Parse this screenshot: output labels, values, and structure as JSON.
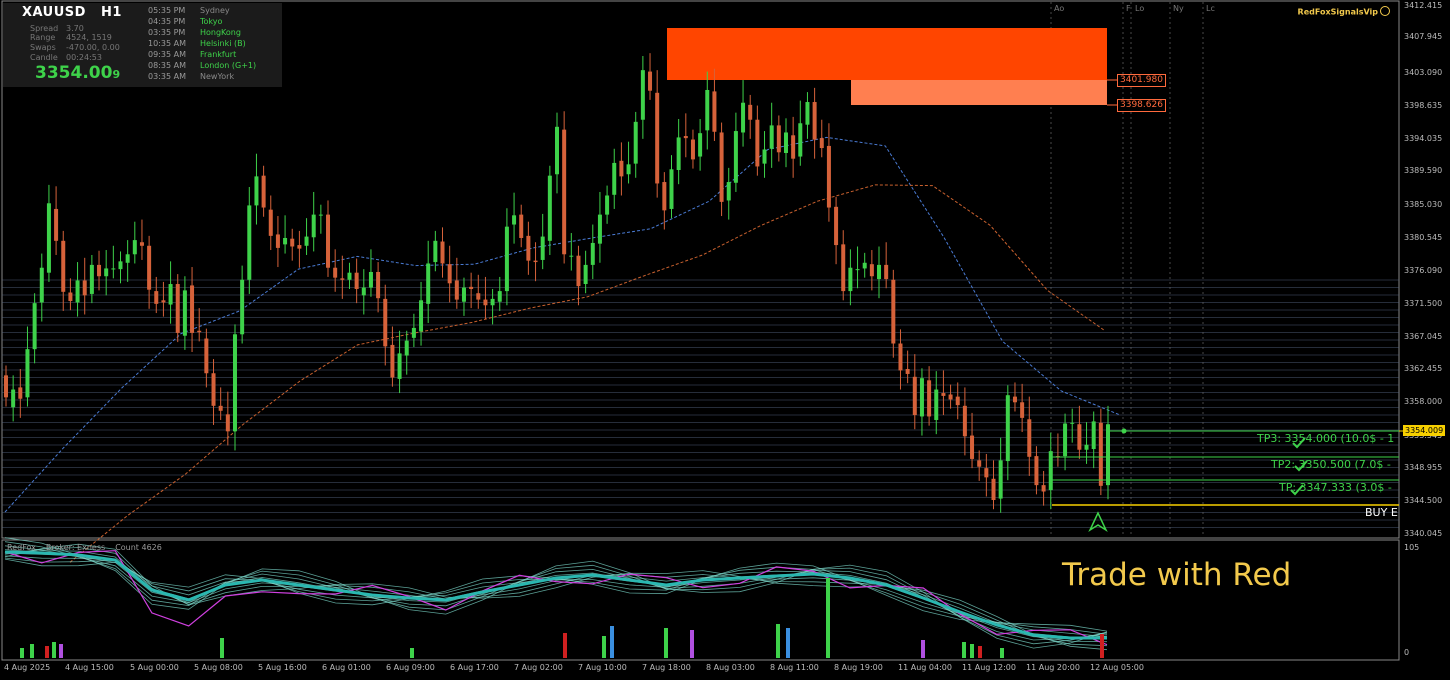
{
  "symbol": {
    "name": "XAUUSD",
    "timeframe": "H1"
  },
  "info": [
    {
      "label": "Spread",
      "value": "3.70"
    },
    {
      "label": "Range",
      "value": "4524, 1519"
    },
    {
      "label": "Swaps",
      "value": "-470.00, 0.00"
    },
    {
      "label": "Candle",
      "value": "00:24:53"
    }
  ],
  "bid": {
    "main": "3354.00",
    "last_digit": "9"
  },
  "sessions": [
    {
      "time": "05:35 PM",
      "city": "Sydney",
      "color": "#8a8a8a"
    },
    {
      "time": "04:35 PM",
      "city": "Tokyo",
      "color": "#3ed24a"
    },
    {
      "time": "03:35 PM",
      "city": "HongKong",
      "color": "#3ed24a"
    },
    {
      "time": "10:35 AM",
      "city": "Helsinki  (B)",
      "color": "#3ed24a"
    },
    {
      "time": "09:35 AM",
      "city": "Frankfurt",
      "color": "#3ed24a"
    },
    {
      "time": "08:35 AM",
      "city": "London  (G+1)",
      "color": "#3ed24a"
    },
    {
      "time": "03:35 AM",
      "city": "NewYork",
      "color": "#8a8a8a"
    }
  ],
  "brand": "RedFoxSignalsVip",
  "separators": [
    "Ao",
    "F",
    "Lo",
    "Ny",
    "Lc"
  ],
  "price_axis": [
    "3412.415",
    "3407.945",
    "3403.090",
    "3398.635",
    "3394.035",
    "3389.590",
    "3385.030",
    "3380.545",
    "3376.090",
    "3371.500",
    "3367.045",
    "3362.455",
    "3358.000",
    "3353.545",
    "3348.955",
    "3344.500",
    "3340.045"
  ],
  "current_price": "3354.009",
  "zones": [
    {
      "price": "3401.980",
      "color": "#ff4500"
    },
    {
      "price": "3398.626",
      "color": "#ff7f50"
    }
  ],
  "targets": [
    {
      "text": "TP3: 3354.000 (10.0$ - 1"
    },
    {
      "text": "TP2: 3350.500 (7.0$ -"
    },
    {
      "text": "TP: 3347.333 (3.0$ -"
    }
  ],
  "entry": {
    "text": "BUY E"
  },
  "indicator": {
    "name": "RedFox",
    "broker": "Broker: Exness",
    "count": "Count  4626",
    "scale_top": "105",
    "scale_bottom": "0"
  },
  "slogan": "Trade with Red",
  "time_axis": [
    "4 Aug 2025",
    "4 Aug 15:00",
    "5 Aug 00:00",
    "5 Aug 08:00",
    "5 Aug 16:00",
    "6 Aug 01:00",
    "6 Aug 09:00",
    "6 Aug 17:00",
    "7 Aug 02:00",
    "7 Aug 10:00",
    "7 Aug 18:00",
    "8 Aug 03:00",
    "8 Aug 11:00",
    "8 Aug 19:00",
    "11 Aug 04:00",
    "11 Aug 12:00",
    "11 Aug 20:00",
    "12 Aug 05:00"
  ],
  "colors": {
    "bull": "#3ed24a",
    "bear": "#d6623a",
    "background": "#000000",
    "grid": "#5a6a8a",
    "ma_fast": "#4a7bd4",
    "ma_slow": "#c8602e"
  },
  "chart_data": {
    "type": "candlestick",
    "ylim": [
      3338.5,
      3413.2
    ],
    "candles": [
      [
        3360.9,
        3357.8
      ],
      [
        3356.4,
        3358.9
      ],
      [
        3359.2,
        3357.6
      ],
      [
        3357.8,
        3364.6
      ],
      [
        3364.6,
        3371.1
      ],
      [
        3371.2,
        3376.1
      ],
      [
        3375.4,
        3385.2
      ],
      [
        3384.4,
        3379.9
      ],
      [
        3379.9,
        3372.7
      ],
      [
        3372.6,
        3371.4
      ],
      [
        3371.2,
        3374.3
      ],
      [
        3374.3,
        3372.2
      ],
      [
        3372.4,
        3376.5
      ],
      [
        3376.5,
        3374.9
      ],
      [
        3374.9,
        3376.0
      ],
      [
        3375.9,
        3376.0
      ],
      [
        3375.9,
        3377.0
      ],
      [
        3376.8,
        3378.0
      ],
      [
        3378.0,
        3380.0
      ],
      [
        3379.7,
        3379.2
      ],
      [
        3379.2,
        3373.0
      ],
      [
        3372.8,
        3371.0
      ],
      [
        3371.5,
        3371.2
      ],
      [
        3370.9,
        3373.8
      ],
      [
        3373.8,
        3366.9
      ],
      [
        3366.5,
        3372.9
      ],
      [
        3373.6,
        3366.9
      ],
      [
        3367.2,
        3367.0
      ],
      [
        3366.1,
        3361.2
      ],
      [
        3361.2,
        3356.6
      ],
      [
        3356.6,
        3355.9
      ],
      [
        3355.4,
        3353.0
      ],
      [
        3353.0,
        3366.7
      ],
      [
        3366.7,
        3374.4
      ],
      [
        3374.4,
        3384.9
      ],
      [
        3384.9,
        3389.0
      ],
      [
        3389.1,
        3384.6
      ],
      [
        3384.3,
        3380.6
      ],
      [
        3380.8,
        3378.9
      ],
      [
        3379.4,
        3380.3
      ],
      [
        3380.2,
        3379.1
      ],
      [
        3379.3,
        3378.8
      ],
      [
        3379.2,
        3380.5
      ],
      [
        3380.4,
        3383.6
      ],
      [
        3383.6,
        3383.6
      ],
      [
        3383.6,
        3376.1
      ],
      [
        3376.1,
        3374.7
      ],
      [
        3374.6,
        3374.4
      ],
      [
        3374.4,
        3375.4
      ],
      [
        3375.4,
        3373.1
      ],
      [
        3372.2,
        3373.3
      ],
      [
        3373.3,
        3375.5
      ],
      [
        3375.5,
        3371.8
      ],
      [
        3371.7,
        3365.0
      ],
      [
        3365.2,
        3360.6
      ],
      [
        3360.4,
        3364.0
      ],
      [
        3363.7,
        3365.8
      ],
      [
        3366.2,
        3367.6
      ],
      [
        3367.1,
        3371.5
      ],
      [
        3371.0,
        3376.7
      ],
      [
        3376.9,
        3379.9
      ],
      [
        3379.8,
        3376.7
      ],
      [
        3376.6,
        3373.9
      ],
      [
        3374.3,
        3371.6
      ],
      [
        3371.3,
        3373.3
      ],
      [
        3373.4,
        3373.1
      ],
      [
        3372.5,
        3371.6
      ],
      [
        3371.6,
        3370.8
      ],
      [
        3370.8,
        3371.7
      ],
      [
        3371.3,
        3372.8
      ],
      [
        3372.8,
        3381.9
      ],
      [
        3382.2,
        3383.5
      ],
      [
        3383.6,
        3380.3
      ],
      [
        3380.6,
        3377.1
      ],
      [
        3377.1,
        3376.9
      ],
      [
        3377.2,
        3380.5
      ],
      [
        3379.9,
        3389.1
      ],
      [
        3389.3,
        3396.0
      ],
      [
        3395.6,
        3378.0
      ],
      [
        3377.7,
        3377.8
      ],
      [
        3377.8,
        3373.5
      ],
      [
        3373.8,
        3376.5
      ],
      [
        3376.5,
        3379.6
      ],
      [
        3379.5,
        3383.6
      ],
      [
        3383.6,
        3386.3
      ],
      [
        3386.4,
        3390.9
      ],
      [
        3391.2,
        3389.0
      ],
      [
        3389.3,
        3390.7
      ],
      [
        3390.8,
        3396.7
      ],
      [
        3397.0,
        3404.0
      ],
      [
        3403.8,
        3401.1
      ],
      [
        3400.8,
        3388.0
      ],
      [
        3388.2,
        3384.2
      ],
      [
        3384.4,
        3390.0
      ],
      [
        3389.9,
        3394.5
      ],
      [
        3394.7,
        3394.4
      ],
      [
        3394.2,
        3391.4
      ],
      [
        3391.8,
        3395.1
      ],
      [
        3395.5,
        3401.2
      ],
      [
        3401.0,
        3395.3
      ],
      [
        3395.2,
        3385.4
      ],
      [
        3385.6,
        3388.2
      ],
      [
        3388.1,
        3395.4
      ],
      [
        3395.2,
        3399.4
      ],
      [
        3399.1,
        3397.0
      ],
      [
        3397.0,
        3390.4
      ],
      [
        3390.8,
        3392.8
      ],
      [
        3392.9,
        3396.2
      ],
      [
        3396.2,
        3392.4
      ],
      [
        3392.3,
        3395.2
      ],
      [
        3394.8,
        3391.5
      ],
      [
        3391.8,
        3396.5
      ],
      [
        3396.3,
        3399.5
      ],
      [
        3399.5,
        3394.2
      ],
      [
        3394.4,
        3393.0
      ],
      [
        3393.3,
        3384.6
      ],
      [
        3384.7,
        3379.3
      ],
      [
        3379.4,
        3372.8
      ],
      [
        3372.8,
        3376.1
      ],
      [
        3375.9,
        3375.9
      ],
      [
        3376.0,
        3376.8
      ],
      [
        3376.6,
        3374.9
      ],
      [
        3374.5,
        3376.5
      ],
      [
        3376.5,
        3374.5
      ],
      [
        3374.4,
        3365.4
      ],
      [
        3365.4,
        3361.6
      ],
      [
        3361.8,
        3361.1
      ],
      [
        3360.7,
        3355.3
      ],
      [
        3355.1,
        3360.5
      ],
      [
        3360.2,
        3355.1
      ],
      [
        3354.6,
        3358.9
      ],
      [
        3358.4,
        3358.0
      ],
      [
        3358.2,
        3357.5
      ],
      [
        3357.9,
        3356.7
      ],
      [
        3356.6,
        3352.3
      ],
      [
        3352.4,
        3349.1
      ],
      [
        3348.9,
        3348.0
      ],
      [
        3347.8,
        3346.5
      ],
      [
        3346.3,
        3343.3
      ],
      [
        3343.5,
        3348.9
      ],
      [
        3348.8,
        3358.1
      ],
      [
        3357.9,
        3357.1
      ],
      [
        3357.1,
        3354.9
      ],
      [
        3354.7,
        3349.4
      ],
      [
        3349.5,
        3345.4
      ],
      [
        3345.4,
        3344.5
      ],
      [
        3344.7,
        3350.2
      ],
      [
        3349.5,
        3349.3
      ],
      [
        3349.5,
        3354.1
      ],
      [
        3354.1,
        3354.2
      ],
      [
        3354.0,
        3350.4
      ],
      [
        3350.4,
        3351.1
      ],
      [
        3350.5,
        3354.4
      ],
      [
        3354.2,
        3345.3
      ],
      [
        3345.4,
        3354.0
      ]
    ],
    "ma_fast": [
      3341.6,
      3350.7,
      3359.2,
      3366.8,
      3370.0,
      3375.9,
      3377.7,
      3376.4,
      3376.6,
      3378.9,
      3380.3,
      3381.6,
      3385.5,
      3392.8,
      3394.5,
      3393.3,
      3380.4,
      3365.7,
      3358.7,
      3355.3
    ],
    "ma_slow": [
      3334.5,
      3341.1,
      3346.9,
      3353.9,
      3360.1,
      3365.2,
      3366.9,
      3368.4,
      3370.4,
      3372.0,
      3375.0,
      3377.9,
      3382.0,
      3385.5,
      3387.8,
      3387.7,
      3382.1,
      3372.9,
      3367.2
    ]
  }
}
